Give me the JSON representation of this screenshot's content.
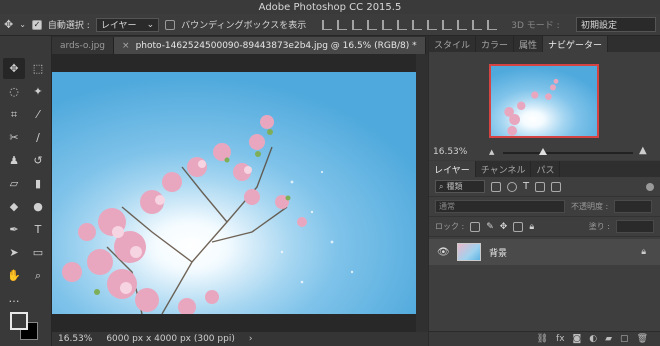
{
  "app": {
    "title": "Adobe Photoshop CC 2015.5"
  },
  "options_bar": {
    "auto_select_label": "自動選択 :",
    "auto_select_checked": true,
    "auto_select_target": "レイヤー",
    "bounding_box_label": "バウンディングボックスを表示",
    "bounding_box_checked": false,
    "mode_3d_label": "3D モード :",
    "workspace": "初期設定"
  },
  "document_tabs": [
    {
      "label": "ards-o.jpg",
      "active": false
    },
    {
      "label": "photo-1462524500090-89443873e2b4.jpg @ 16.5% (RGB/8) *",
      "active": true
    }
  ],
  "status": {
    "zoom": "16.53%",
    "doc_info": "6000 px x 4000 px (300 ppi)",
    "arrow": "›"
  },
  "top_panel": {
    "tabs": [
      {
        "label": "スタイル",
        "active": false
      },
      {
        "label": "カラー",
        "active": false
      },
      {
        "label": "属性",
        "active": false
      },
      {
        "label": "ナビゲーター",
        "active": true
      }
    ],
    "zoom": "16.53%",
    "zoom_fraction": 0.33
  },
  "layers_panel": {
    "tabs": [
      {
        "label": "レイヤー",
        "active": true
      },
      {
        "label": "チャンネル",
        "active": false
      },
      {
        "label": "パス",
        "active": false
      }
    ],
    "filter_label": "種類",
    "blend_mode": "通常",
    "opacity_label": "不透明度 :",
    "lock_label": "ロック :",
    "fill_label": "塗り :",
    "layers": [
      {
        "name": "背景",
        "visible": true,
        "locked": true
      }
    ]
  },
  "colors": {
    "sky": "#5fb4e2",
    "blossom": "#e9a7bf",
    "panel_bg": "#3e3e3e",
    "nav_frame": "#d64343"
  }
}
